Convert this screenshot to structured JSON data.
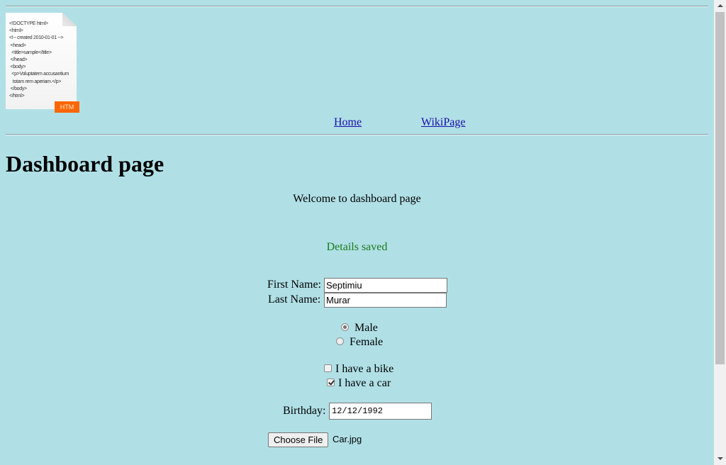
{
  "logo": {
    "code_lines": [
      "<!DOCTYPE html>",
      "<html>",
      "<!-- created 2010-01-01 -->",
      " <head>",
      "  <title>sample</title>",
      " </head>",
      " <body>",
      "  <p>Voluptatem accusantium",
      "   totam rem aperiam.</p>",
      " </body>",
      "</html>"
    ],
    "tag": "HTM"
  },
  "nav": {
    "home": "Home",
    "wiki": "WikiPage"
  },
  "main": {
    "title": "Dashboard page",
    "welcome": "Welcome to dashboard page",
    "status": "Details saved"
  },
  "form": {
    "first_name_label": "First Name:",
    "first_name_value": "Septimiu",
    "last_name_label": "Last Name:",
    "last_name_value": "Murar",
    "gender_options": [
      {
        "label": "Male",
        "checked": true
      },
      {
        "label": "Female",
        "checked": false
      }
    ],
    "vehicle_options": [
      {
        "label": "I have a bike",
        "checked": false
      },
      {
        "label": "I have a car",
        "checked": true
      }
    ],
    "birthday_label": "Birthday:",
    "birthday_value": "12/12/1992",
    "file_button": "Choose File",
    "file_name": "Car.jpg"
  }
}
